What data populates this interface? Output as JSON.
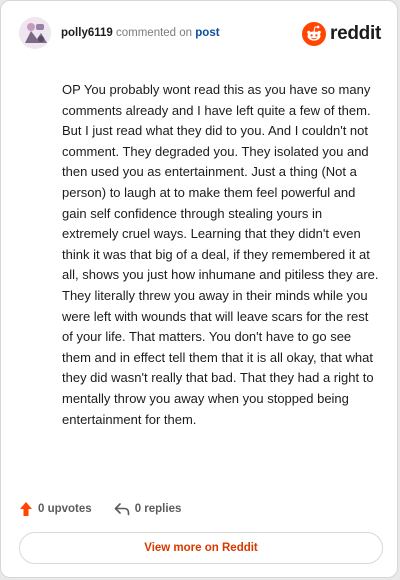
{
  "comment": {
    "username": "polly6119",
    "commented_text": "commented on",
    "post_link": "post",
    "body": "OP You probably wont read this as you have so many comments already and I have left quite a few of them. But I just read what they did to you. And I couldn't not comment. They degraded you. They isolated you and then used you as entertainment. Just a thing (Not a person) to laugh at to make them feel powerful and gain self confidence through stealing yours in extremely cruel ways. Learning that they didn't even think it was that big of a deal, if they remembered it at all, shows you just how inhumane and pitiless they are. They literally threw you away in their minds while you were left with wounds that will leave scars for the rest of your life. That matters. You don't have to go see them and in effect tell them that it is all okay, that what they did wasn't really that bad. That they had a right to mentally throw you away when you stopped being entertainment for them."
  },
  "brand": {
    "wordmark": "reddit",
    "icon": "reddit-logo-icon",
    "color": "#ff4500"
  },
  "actions": {
    "upvotes": "0 upvotes",
    "replies": "0 replies",
    "upvote_icon": "upvote-arrow-icon",
    "reply_icon": "reply-arrow-icon"
  },
  "footer": {
    "view_more_label": "View more on Reddit"
  },
  "colors": {
    "accent": "#d93900",
    "upvote": "#ff4500",
    "link": "#0b4f9c"
  }
}
